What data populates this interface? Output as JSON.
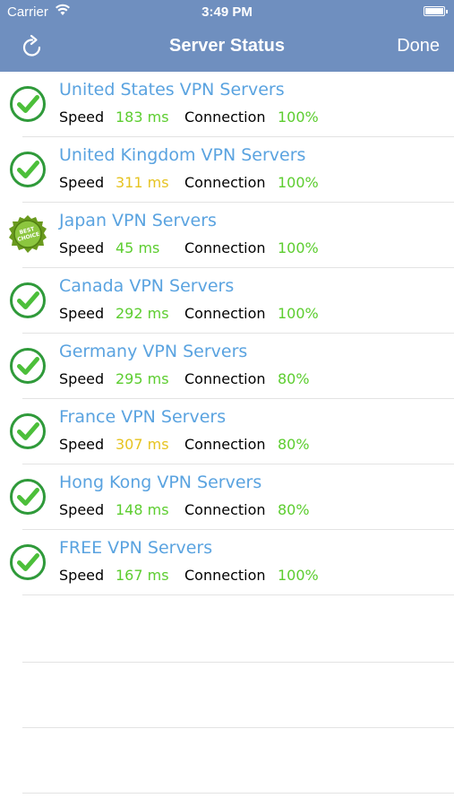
{
  "status_bar": {
    "carrier": "Carrier",
    "time": "3:49 PM"
  },
  "nav": {
    "title": "Server Status",
    "done_label": "Done",
    "refresh_icon": "refresh-icon"
  },
  "labels": {
    "speed": "Speed",
    "connection": "Connection"
  },
  "colors": {
    "nav_bg": "#6f8fbf",
    "link": "#5aa3e0",
    "good": "#5ccd2f",
    "warn": "#e6c320",
    "check": "#2f9a3a"
  },
  "servers": [
    {
      "name": "United States VPN Servers",
      "speed": "183 ms",
      "speed_color": "green",
      "connection": "100%",
      "icon": "check-icon"
    },
    {
      "name": "United Kingdom VPN Servers",
      "speed": "311 ms",
      "speed_color": "yellow",
      "connection": "100%",
      "icon": "check-icon"
    },
    {
      "name": "Japan VPN Servers",
      "speed": "45 ms",
      "speed_color": "green",
      "connection": "100%",
      "icon": "best-choice-badge-icon",
      "badge_text": "BEST CHOICE"
    },
    {
      "name": "Canada VPN Servers",
      "speed": "292 ms",
      "speed_color": "green",
      "connection": "100%",
      "icon": "check-icon"
    },
    {
      "name": "Germany VPN Servers",
      "speed": "295 ms",
      "speed_color": "green",
      "connection": "80%",
      "icon": "check-icon"
    },
    {
      "name": "France VPN Servers",
      "speed": "307 ms",
      "speed_color": "yellow",
      "connection": "80%",
      "icon": "check-icon"
    },
    {
      "name": "Hong Kong VPN Servers",
      "speed": "148 ms",
      "speed_color": "green",
      "connection": "80%",
      "icon": "check-icon"
    },
    {
      "name": "FREE VPN Servers",
      "speed": "167 ms",
      "speed_color": "green",
      "connection": "100%",
      "icon": "check-icon"
    }
  ]
}
